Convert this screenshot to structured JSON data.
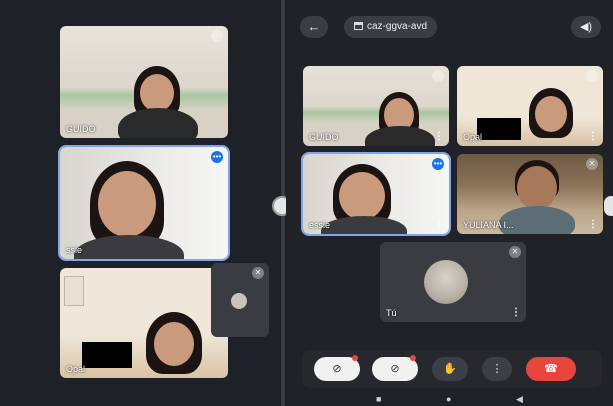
{
  "meeting": {
    "code": "caz-ggva-avd"
  },
  "left_tiles": [
    {
      "name": "GUIDO"
    },
    {
      "name": "ssie"
    },
    {
      "name": "Opal"
    }
  ],
  "right_tiles": [
    {
      "name": "GUIDO"
    },
    {
      "name": "Opal"
    },
    {
      "name": "essie"
    },
    {
      "name": "YULIANA I..."
    },
    {
      "name": "Tú"
    }
  ],
  "icons": {
    "back": "arrow-left-icon",
    "meeting_code": "calendar-icon",
    "speaker": "speaker-icon",
    "mic_off": "mic-off-icon",
    "mic_active": "mic-active-icon",
    "camera_off": "camera-off-icon",
    "raise_hand": "hand-icon",
    "more": "more-vert-icon",
    "end_call": "phone-hangup-icon"
  },
  "colors": {
    "end_call": "#e8453c",
    "speaking": "#1a73e8"
  }
}
